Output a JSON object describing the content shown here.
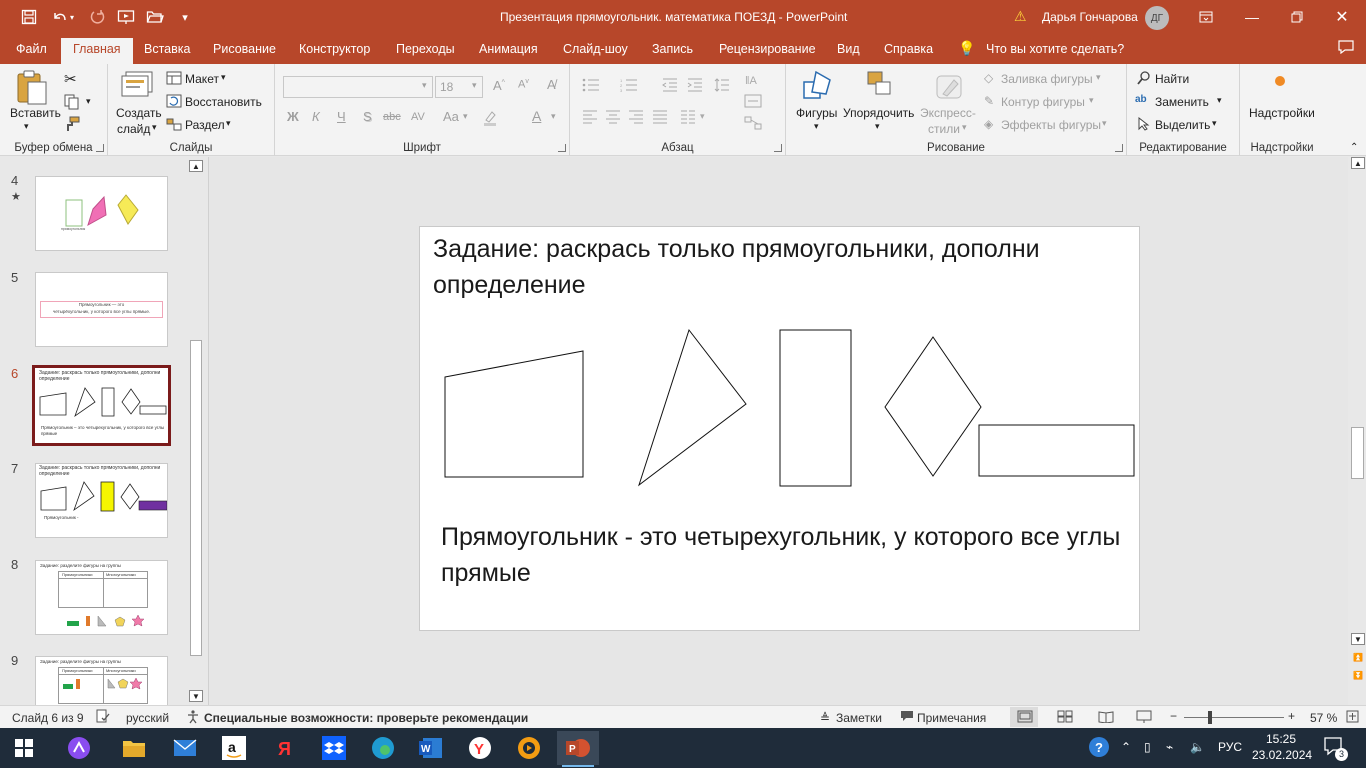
{
  "titlebar": {
    "title": "Презентация прямоугольник. математика ПОЕЗД  -  PowerPoint",
    "user": "Дарья Гончарова",
    "avatar": "ДГ",
    "icons": [
      "save-icon",
      "undo-icon",
      "redo-icon",
      "start-slideshow-icon",
      "open-icon",
      "customize-icon"
    ]
  },
  "tabs": [
    "Файл",
    "Главная",
    "Вставка",
    "Рисование",
    "Конструктор",
    "Переходы",
    "Анимация",
    "Слайд-шоу",
    "Запись",
    "Рецензирование",
    "Вид",
    "Справка"
  ],
  "tell_me": "Что вы хотите сделать?",
  "ribbon": {
    "clipboard": {
      "label": "Буфер обмена",
      "paste": "Вставить"
    },
    "slides": {
      "label": "Слайды",
      "new_slide_1": "Создать",
      "new_slide_2": "слайд",
      "layout": "Макет",
      "reset": "Восстановить",
      "section": "Раздел"
    },
    "font": {
      "label": "Шрифт",
      "size": "18",
      "bold": "Ж",
      "italic": "К",
      "underline": "Ч",
      "shadow": "S",
      "strike": "abc",
      "spacing": "AV",
      "case": "Aa",
      "clear": "A",
      "color": "A"
    },
    "paragraph": {
      "label": "Абзац"
    },
    "drawing": {
      "label": "Рисование",
      "shapes": "Фигуры",
      "arrange": "Упорядочить",
      "quick_styles_1": "Экспресс-",
      "quick_styles_2": "стили",
      "fill": "Заливка фигуры",
      "outline": "Контур фигуры",
      "effects": "Эффекты фигуры"
    },
    "editing": {
      "label": "Редактирование",
      "find": "Найти",
      "replace": "Заменить",
      "select": "Выделить"
    },
    "addins": {
      "label": "Надстройки",
      "button": "Надстройки"
    }
  },
  "thumbnails": [
    {
      "num": "4",
      "star": "★",
      "caption": "прямоугольник"
    },
    {
      "num": "5",
      "text1": "Прямоугольник — это",
      "text2": "четырёхугольник, у которого все углы прямые."
    },
    {
      "num": "6",
      "title": "Задание: раскрась только прямоугольники, дополни определение",
      "caption": "Прямоугольник – это четырехугольник, у которого все углы прямые"
    },
    {
      "num": "7",
      "title": "Задание: раскрась только прямоугольники, дополни определение",
      "caption": "Прямоугольник -"
    },
    {
      "num": "8",
      "title": "Задание: разделите фигуры на группы",
      "col1": "Прямоугольники",
      "col2": "Многоугольники"
    },
    {
      "num": "9",
      "title": "Задание: разделите фигуры на группы",
      "col1": "Прямоугольники",
      "col2": "Многоугольники"
    }
  ],
  "slide": {
    "title": "Задание: раскрась только прямоугольники, дополни определение",
    "definition": "Прямоугольник -  это четырехугольник, у которого все углы прямые"
  },
  "status": {
    "slide_counter": "Слайд 6 из 9",
    "language": "русский",
    "accessibility": "Специальные возможности: проверьте рекомендации",
    "notes": "Заметки",
    "comments": "Примечания",
    "zoom": "57 %"
  },
  "taskbar": {
    "lang": "РУС",
    "time": "15:25",
    "date": "23.02.2024",
    "notifications": "3"
  },
  "colors": {
    "accent": "#b7472a",
    "selected_thumb_border": "#7b1b1b",
    "taskbar": "#1f2c3a"
  }
}
